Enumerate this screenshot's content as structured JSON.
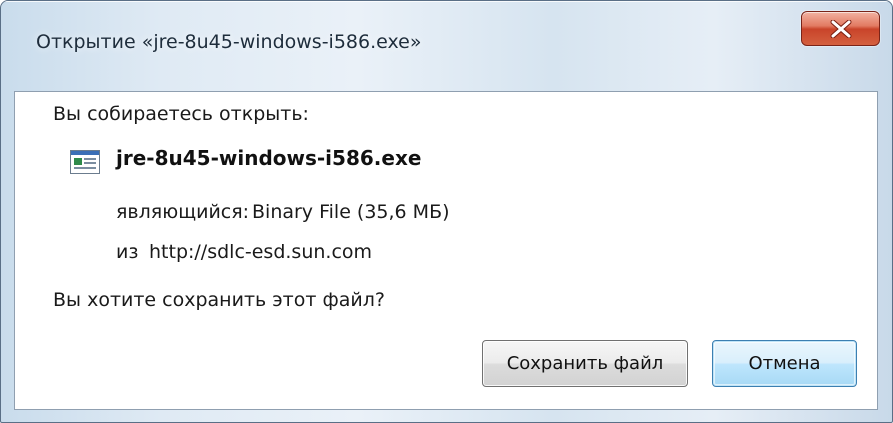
{
  "window": {
    "title": "Открытие «jre-8u45-windows-i586.exe»",
    "close_icon": "close-icon"
  },
  "dialog": {
    "heading": "Вы собираетесь открыть:",
    "file_icon": "exe-file-icon",
    "file_name": "jre-8u45-windows-i586.exe",
    "type_label": "являющийся:",
    "type_value": "Binary File (35,6 МБ)",
    "from_label": "из",
    "from_value": "http://sdlc-esd.sun.com",
    "question": "Вы хотите сохранить этот файл?"
  },
  "buttons": {
    "save_label": "Сохранить файл",
    "cancel_label": "Отмена"
  },
  "colors": {
    "close_button": "#d4603f",
    "focused_button_border": "#3c7fb1"
  }
}
